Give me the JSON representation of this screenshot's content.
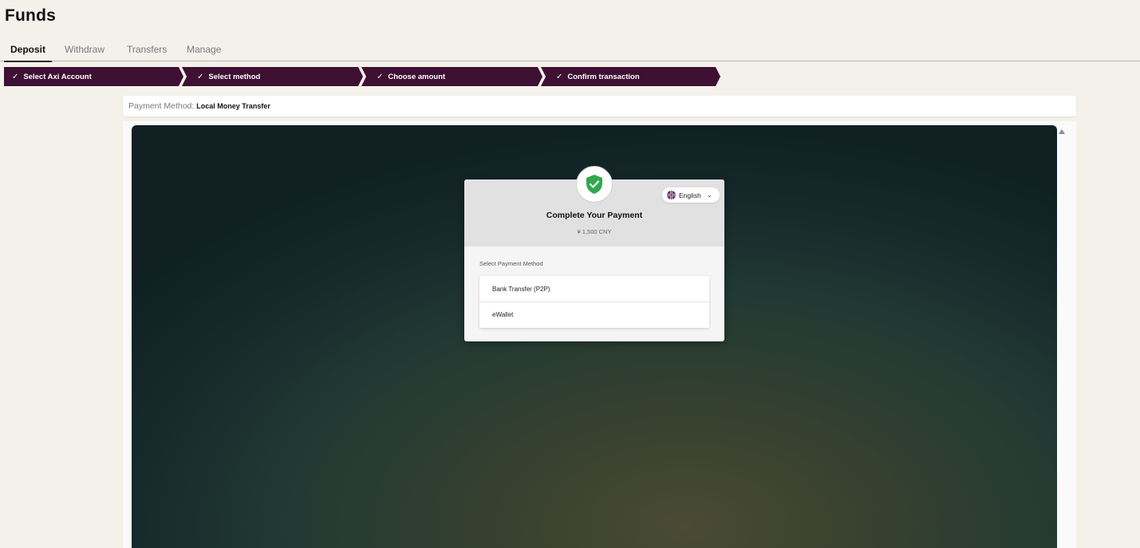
{
  "page": {
    "title": "Funds"
  },
  "tabs": [
    {
      "label": "Deposit",
      "active": true
    },
    {
      "label": "Withdraw",
      "active": false
    },
    {
      "label": "Transfers",
      "active": false
    },
    {
      "label": "Manage",
      "active": false
    }
  ],
  "steps": [
    {
      "label": "Select Axi Account"
    },
    {
      "label": "Select method"
    },
    {
      "label": "Choose amount"
    },
    {
      "label": "Confirm transaction"
    }
  ],
  "method_bar": {
    "label": "Payment Method:",
    "value": "Local Money Transfer"
  },
  "payment_widget": {
    "language": "English",
    "title": "Complete Your Payment",
    "amount": "¥ 1,500 CNY",
    "select_label": "Select Payment Method",
    "options": [
      "Bank Transfer (P2P)",
      "eWallet"
    ]
  },
  "colors": {
    "step_bg": "#3e1033",
    "page_bg": "#f4f1eb",
    "shield_green": "#2fa84f"
  },
  "icons": {
    "step_check": "check-icon",
    "badge": "shield-check-icon",
    "language": "uk-flag-icon",
    "dropdown": "chevron-down-icon"
  }
}
